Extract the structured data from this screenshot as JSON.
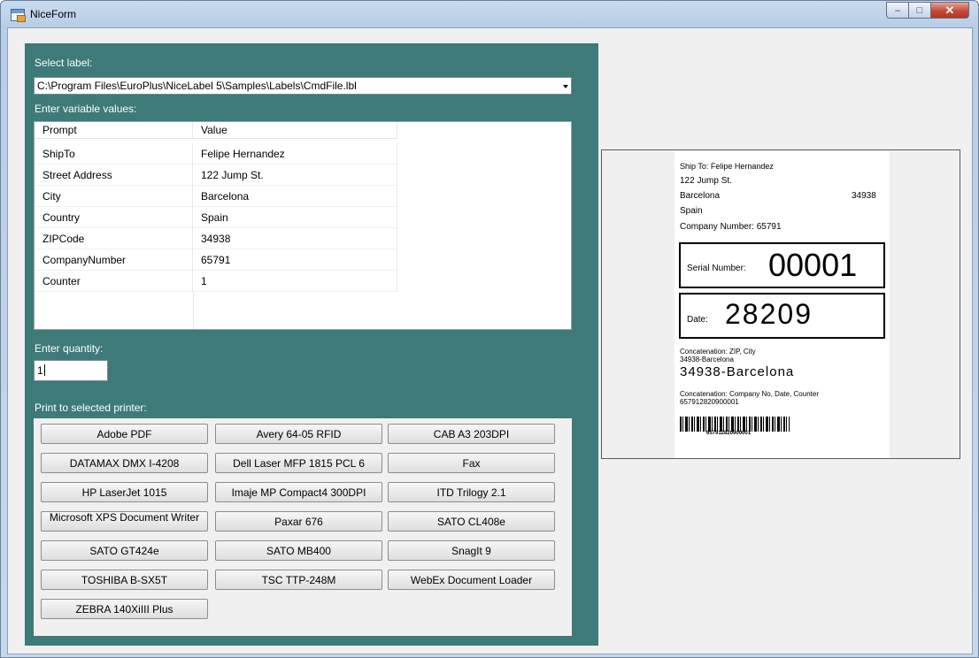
{
  "window": {
    "title": "NiceForm",
    "min_glyph": "–",
    "max_glyph": "□",
    "close_glyph": "✕"
  },
  "form": {
    "select_label_caption": "Select label:",
    "label_path": "C:\\Program Files\\EuroPlus\\NiceLabel 5\\Samples\\Labels\\CmdFile.lbl",
    "variables_caption": "Enter variable values:",
    "grid_headers": {
      "prompt": "Prompt",
      "value": "Value"
    },
    "variables": [
      {
        "prompt": "ShipTo",
        "value": "Felipe Hernandez"
      },
      {
        "prompt": "Street Address",
        "value": "122 Jump St."
      },
      {
        "prompt": "City",
        "value": "Barcelona"
      },
      {
        "prompt": "Country",
        "value": "Spain"
      },
      {
        "prompt": "ZIPCode",
        "value": "34938"
      },
      {
        "prompt": "CompanyNumber",
        "value": "65791"
      },
      {
        "prompt": "Counter",
        "value": "1"
      }
    ],
    "quantity_caption": "Enter quantity:",
    "quantity_value": "1",
    "printers_caption": "Print to selected printer:",
    "printers": [
      "Adobe PDF",
      "Avery 64-05 RFID",
      "CAB A3 203DPI",
      "DATAMAX DMX I-4208",
      "Dell Laser MFP 1815 PCL 6",
      "Fax",
      "HP LaserJet 1015",
      "Imaje MP Compact4 300DPI",
      "ITD Trilogy 2.1",
      "Microsoft XPS Document Writer",
      "Paxar 676",
      "SATO CL408e",
      "SATO GT424e",
      "SATO MB400",
      "SnagIt 9",
      "TOSHIBA B-SX5T",
      "TSC TTP-248M",
      "WebEx Document Loader",
      "ZEBRA 140XiIII Plus"
    ]
  },
  "label_preview": {
    "ship_to": "Ship To: Felipe Hernandez",
    "street": "122 Jump St.",
    "city": "Barcelona",
    "zip": "34938",
    "country": "Spain",
    "company": "Company Number: 65791",
    "serial_caption": "Serial Number:",
    "serial_value": "00001",
    "date_caption": "Date:",
    "date_value": "28209",
    "concat1_caption": "Concatenation: ZIP, City",
    "concat1_small": "34938-Barcelona",
    "concat1_big": "34938-Barcelona",
    "concat2_caption": "Concatenation: Company No, Date, Counter",
    "concat2_value": "657912820900001",
    "barcode_text": "657912820900001"
  }
}
